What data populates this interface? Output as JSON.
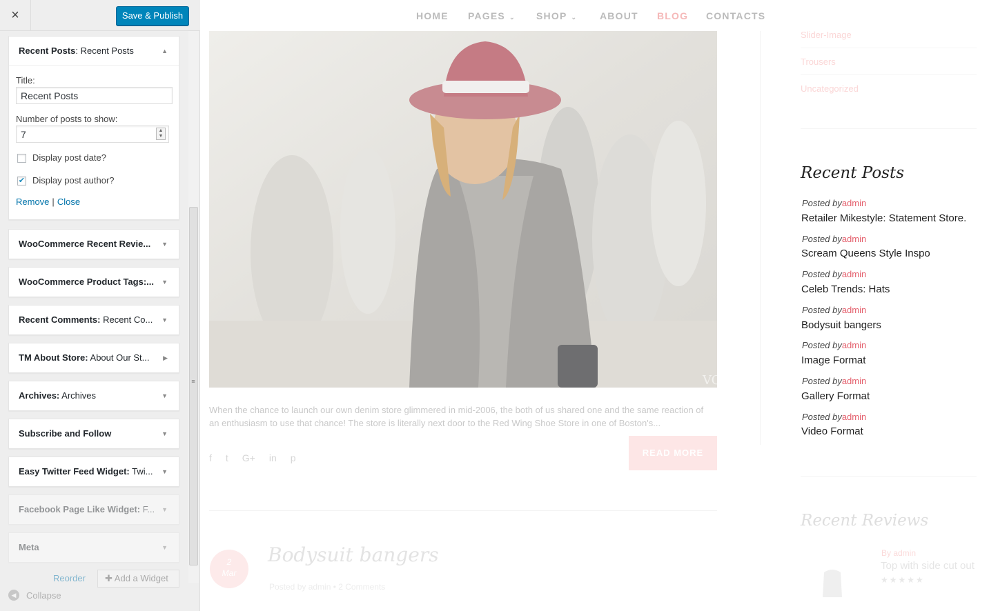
{
  "customizer": {
    "close_label": "×",
    "publish_label": "Save & Publish",
    "open_widget": {
      "type": "Recent Posts",
      "title": "Recent Posts",
      "form": {
        "title_label": "Title:",
        "title_value": "Recent Posts",
        "number_label": "Number of posts to show:",
        "number_value": "7",
        "display_date_label": "Display post date?",
        "display_date_checked": false,
        "display_author_label": "Display post author?",
        "display_author_checked": true,
        "remove_label": "Remove",
        "separator": "|",
        "close_label": "Close"
      }
    },
    "widgets": [
      {
        "type": "WooCommerce Recent Revie...",
        "title": ""
      },
      {
        "type": "WooCommerce Product Tags:...",
        "title": ""
      },
      {
        "type": "Recent Comments:",
        "title": " Recent Co..."
      },
      {
        "type": "TM About Store:",
        "title": " About Our St..."
      },
      {
        "type": "Archives:",
        "title": " Archives"
      },
      {
        "type": "Subscribe and Follow",
        "title": ""
      },
      {
        "type": "Easy Twitter Feed Widget:",
        "title": " Twi..."
      },
      {
        "type": "Facebook Page Like Widget:",
        "title": " F..."
      },
      {
        "type": "Meta",
        "title": ""
      }
    ],
    "reorder_label": "Reorder",
    "add_widget_label": "Add a Widget",
    "collapse_label": "Collapse",
    "accent": "#0085ba"
  },
  "preview": {
    "nav": [
      "HOME",
      "PAGES",
      "SHOP",
      "ABOUT",
      "BLOG",
      "CONTACTS"
    ],
    "active_nav": "BLOG",
    "hero_watermark": "VOG",
    "excerpt": "When the chance to launch our own denim store glimmered in mid-2006, the both of us shared one and the same reaction of an enthusiasm to use that chance! The store is literally next door to the Red Wing Shoe Store in one of Boston's...",
    "read_more": "READ MORE",
    "social": [
      "f",
      "t",
      "G+",
      "in",
      "p"
    ],
    "next_post": {
      "day": "2",
      "month": "Mar",
      "title": "Bodysuit bangers",
      "meta": "Posted by admin  •  2 Comments"
    },
    "categories": [
      "Slider-Image",
      "Trousers",
      "Uncategorized"
    ],
    "recent_posts": {
      "heading": "Recent Posts",
      "posted_by": "Posted by",
      "author": "admin",
      "items": [
        "Retailer Mikestyle: Statement Store.",
        "Scream Queens Style Inspo",
        "Celeb Trends: Hats",
        "Bodysuit bangers",
        "Image Format",
        "Gallery Format",
        "Video Format"
      ]
    },
    "recent_reviews": {
      "heading": "Recent Reviews",
      "author": "By admin",
      "text": "Top with side cut out",
      "rating": 3,
      "stars": "★★★★★"
    },
    "accent": "#e4606d"
  }
}
